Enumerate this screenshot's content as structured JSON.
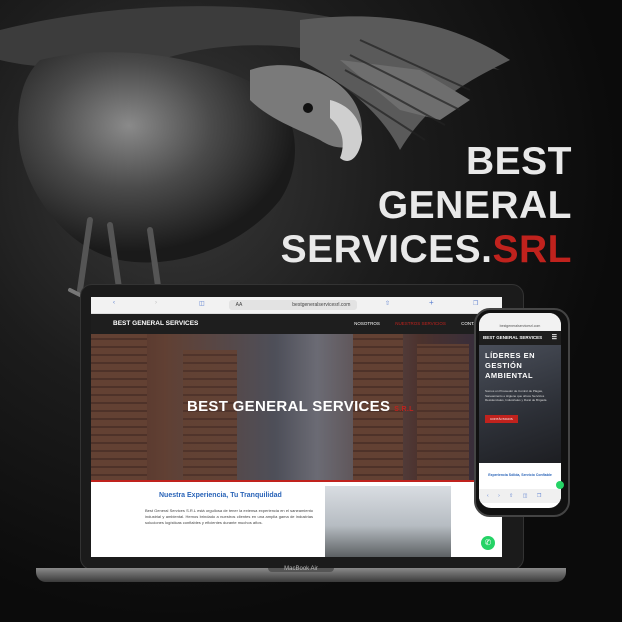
{
  "headline": {
    "line1": "BEST",
    "line2": "GENERAL",
    "line3_main": "SERVICES.",
    "line3_accent": "SRL"
  },
  "colors": {
    "accent_red": "#c0221d",
    "link_blue": "#2a64b8",
    "whatsapp": "#25d366",
    "nav_dark": "#1e1e1e"
  },
  "laptop": {
    "browser": {
      "text_size": "AA",
      "url": "bestgeneralservicesrl.com"
    },
    "site": {
      "brand": "BEST GENERAL SERVICES",
      "nav": [
        "NOSOTROS",
        "NUESTROS SERVICIOS",
        "CONTACTO"
      ],
      "hero_title": "BEST GENERAL SERVICES",
      "hero_suffix": "S.R.L",
      "section_title": "Nuestra Experiencia, Tu Tranquilidad",
      "section_text": "Best General Services S.R.L está orgullosa de tener la extensa experiencia en el saneamiento industrial y ambiental. Hemos brindado a nuestros clientes en una amplia gama de industrias soluciones logísticas confiables y eficientes durante muchos años."
    },
    "label": "MacBook Air"
  },
  "phone": {
    "url": "bestgeneralservicesrl.com",
    "brand": "BEST GENERAL SERVICES",
    "hero_title": "LÍDERES EN GESTIÓN AMBIENTAL",
    "hero_text": "Somos un Proveedor de Control de Plagas, Saneamiento e Higiene que ofrece Servicios Residenciales, Industriales y Rural de Brigada",
    "button": "CONTÁCTANOS",
    "section_title": "Experiencia Sólida, Servicio Confiable"
  }
}
